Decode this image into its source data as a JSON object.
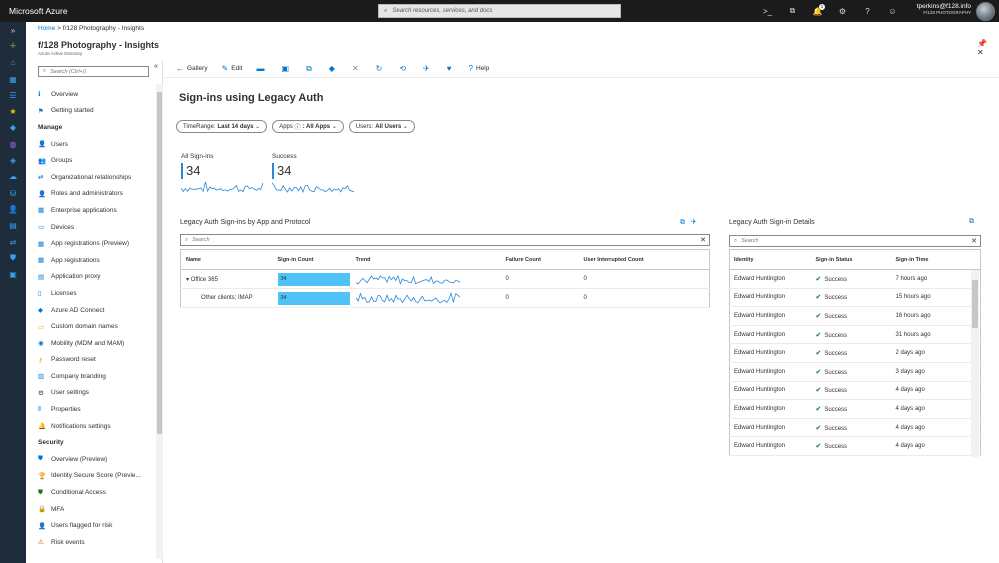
{
  "topbar": {
    "brand": "Microsoft Azure",
    "search_placeholder": "Search resources, services, and docs",
    "notification_count": "1",
    "email": "tperkins@f128.info",
    "tenant": "F/128 PHOTOGRAPHY"
  },
  "breadcrumb": {
    "home": "Home",
    "sep": ">",
    "current": "f/128 Photography - Insights"
  },
  "blade": {
    "title": "f/128 Photography - Insights",
    "subtitle": "Azure Active Directory"
  },
  "nav": {
    "search_placeholder": "Search (Ctrl+/)",
    "top": [
      {
        "label": "Overview",
        "icon": "info-icon",
        "glyph": "ℹ",
        "color": "#0078d4"
      },
      {
        "label": "Getting started",
        "icon": "rocket-icon",
        "glyph": "⚑",
        "color": "#0078d4"
      }
    ],
    "manage_header": "Manage",
    "manage": [
      {
        "label": "Users",
        "icon": "user-icon",
        "glyph": "👤",
        "color": "#0078d4"
      },
      {
        "label": "Groups",
        "icon": "group-icon",
        "glyph": "👥",
        "color": "#0078d4"
      },
      {
        "label": "Organizational relationships",
        "icon": "org-icon",
        "glyph": "⇄",
        "color": "#0078d4"
      },
      {
        "label": "Roles and administrators",
        "icon": "roles-icon",
        "glyph": "👤",
        "color": "#0078d4"
      },
      {
        "label": "Enterprise applications",
        "icon": "apps-icon",
        "glyph": "▦",
        "color": "#0078d4"
      },
      {
        "label": "Devices",
        "icon": "device-icon",
        "glyph": "▭",
        "color": "#0078d4"
      },
      {
        "label": "App registrations (Preview)",
        "icon": "app-reg-icon",
        "glyph": "▦",
        "color": "#0078d4"
      },
      {
        "label": "App registrations",
        "icon": "app-reg-icon",
        "glyph": "▦",
        "color": "#0078d4"
      },
      {
        "label": "Application proxy",
        "icon": "proxy-icon",
        "glyph": "▤",
        "color": "#0078d4"
      },
      {
        "label": "Licenses",
        "icon": "license-icon",
        "glyph": "▯",
        "color": "#0078d4"
      },
      {
        "label": "Azure AD Connect",
        "icon": "connect-icon",
        "glyph": "◆",
        "color": "#0078d4"
      },
      {
        "label": "Custom domain names",
        "icon": "domain-icon",
        "glyph": "▭",
        "color": "#f7a800"
      },
      {
        "label": "Mobility (MDM and MAM)",
        "icon": "mobility-icon",
        "glyph": "◉",
        "color": "#0078d4"
      },
      {
        "label": "Password reset",
        "icon": "key-icon",
        "glyph": "⚷",
        "color": "#f7a800"
      },
      {
        "label": "Company branding",
        "icon": "branding-icon",
        "glyph": "▥",
        "color": "#0078d4"
      },
      {
        "label": "User settings",
        "icon": "gear-icon",
        "glyph": "⚙",
        "color": "#323130"
      },
      {
        "label": "Properties",
        "icon": "properties-icon",
        "glyph": "⦀",
        "color": "#0078d4"
      },
      {
        "label": "Notifications settings",
        "icon": "bell-icon",
        "glyph": "🔔",
        "color": "#f7a800"
      }
    ],
    "security_header": "Security",
    "security": [
      {
        "label": "Overview (Preview)",
        "icon": "shield-icon",
        "glyph": "⛊",
        "color": "#0078d4"
      },
      {
        "label": "Identity Secure Score (Previe...",
        "icon": "trophy-icon",
        "glyph": "🏆",
        "color": "#f7a800"
      },
      {
        "label": "Conditional Access",
        "icon": "shield-check-icon",
        "glyph": "⛊",
        "color": "#107c10"
      },
      {
        "label": "MFA",
        "icon": "lock-icon",
        "glyph": "🔒",
        "color": "#323130"
      },
      {
        "label": "Users flagged for risk",
        "icon": "user-risk-icon",
        "glyph": "👤",
        "color": "#0078d4"
      },
      {
        "label": "Risk events",
        "icon": "warning-icon",
        "glyph": "⚠",
        "color": "#d83b01"
      }
    ]
  },
  "toolbar": {
    "gallery": "Gallery",
    "edit": "Edit",
    "help": "Help"
  },
  "page": {
    "title": "Sign-ins using Legacy Auth",
    "filters": [
      {
        "key": "TimeRange:",
        "value": "Last 14 days"
      },
      {
        "key": "Apps",
        "value": ": All Apps"
      },
      {
        "key": "Users:",
        "value": "All Users"
      }
    ],
    "metrics": [
      {
        "label": "All Sign-ins",
        "value": "34"
      },
      {
        "label": "Success",
        "value": "34"
      }
    ]
  },
  "left_panel": {
    "title": "Legacy Auth Sign-ins by App and Protocol",
    "search_placeholder": "Search",
    "columns": [
      "Name",
      "Sign-in Count",
      "Trend",
      "Failure Count",
      "User Interrupted Count"
    ],
    "rows": [
      {
        "name": "Office 365",
        "count": "34",
        "failure": "0",
        "interrupted": "0"
      },
      {
        "name": "Other clients; IMAP",
        "count": "34",
        "failure": "0",
        "interrupted": "0"
      }
    ]
  },
  "right_panel": {
    "title": "Legacy Auth Sign-in Details",
    "search_placeholder": "Search",
    "columns": [
      "Identity",
      "Sign-in Status",
      "Sign-in Time"
    ],
    "rows": [
      {
        "identity": "Edward Huntington",
        "status": "Success",
        "time": "7 hours ago"
      },
      {
        "identity": "Edward Huntington",
        "status": "Success",
        "time": "15 hours ago"
      },
      {
        "identity": "Edward Huntington",
        "status": "Success",
        "time": "16 hours ago"
      },
      {
        "identity": "Edward Huntington",
        "status": "Success",
        "time": "31 hours ago"
      },
      {
        "identity": "Edward Huntington",
        "status": "Success",
        "time": "2 days ago"
      },
      {
        "identity": "Edward Huntington",
        "status": "Success",
        "time": "3 days ago"
      },
      {
        "identity": "Edward Huntington",
        "status": "Success",
        "time": "4 days ago"
      },
      {
        "identity": "Edward Huntington",
        "status": "Success",
        "time": "4 days ago"
      },
      {
        "identity": "Edward Huntington",
        "status": "Success",
        "time": "4 days ago"
      },
      {
        "identity": "Edward Huntington",
        "status": "Success",
        "time": "4 days ago"
      }
    ]
  },
  "colors": {
    "accent": "#0078d4",
    "bar": "#4fc3f7",
    "sparkline": "#2b88d8",
    "success": "#107c10"
  }
}
